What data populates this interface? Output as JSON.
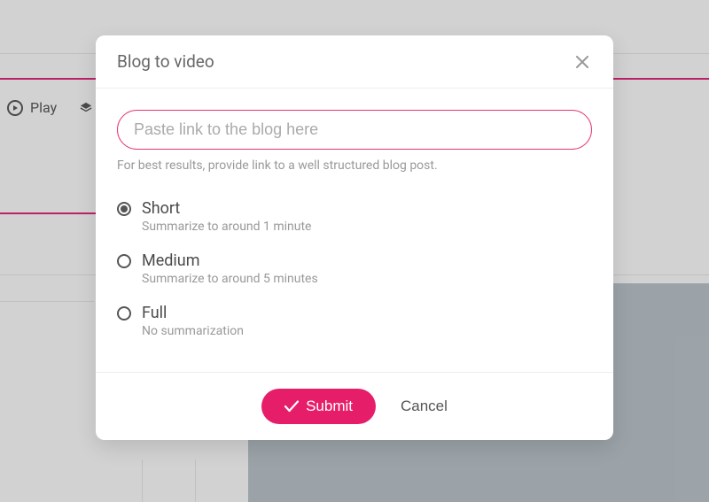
{
  "background": {
    "play_label": "Play"
  },
  "modal": {
    "title": "Blog to video",
    "urlInput": {
      "placeholder": "Paste link to the blog here",
      "value": ""
    },
    "hint": "For best results, provide link to a well structured blog post.",
    "options": [
      {
        "label": "Short",
        "description": "Summarize to around 1 minute",
        "checked": true
      },
      {
        "label": "Medium",
        "description": "Summarize to around 5 minutes",
        "checked": false
      },
      {
        "label": "Full",
        "description": "No summarization",
        "checked": false
      }
    ],
    "submit_label": "Submit",
    "cancel_label": "Cancel"
  }
}
